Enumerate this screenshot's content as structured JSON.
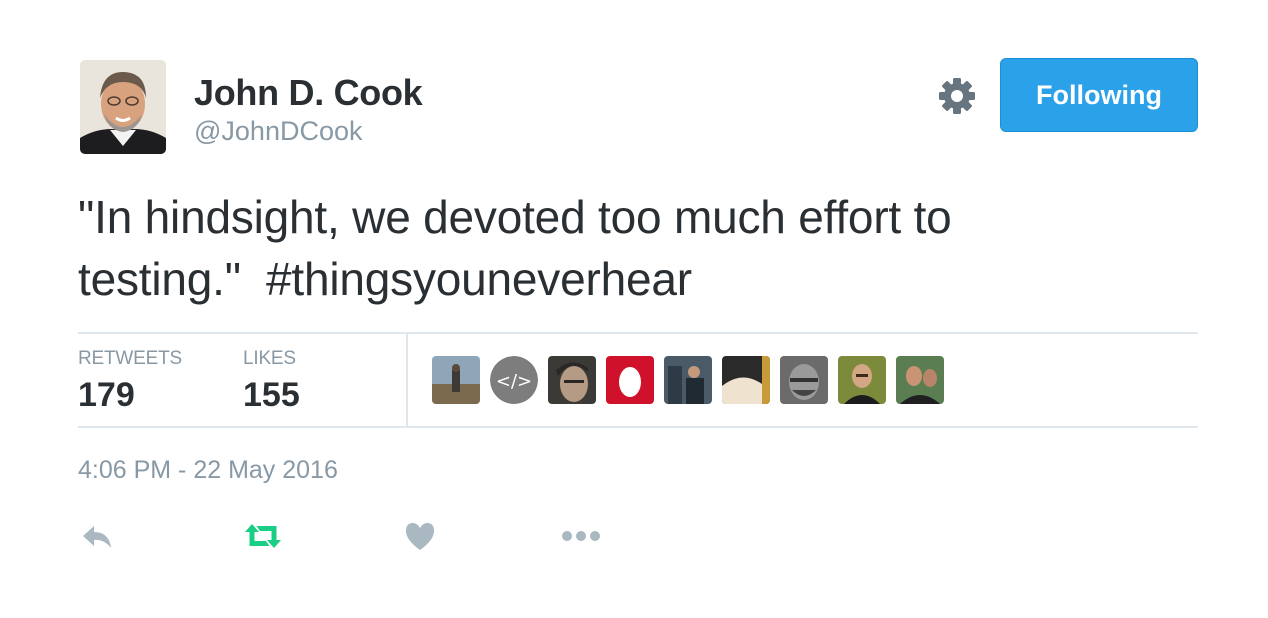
{
  "author": {
    "name": "John D. Cook",
    "handle": "@JohnDCook"
  },
  "header": {
    "follow_button_label": "Following",
    "settings_icon": "gear-icon"
  },
  "tweet": {
    "text": "\"In hindsight, we devoted too much effort to testing.\"",
    "hashtag": "#thingsyouneverhear",
    "timestamp": "4:06 PM - 22 May 2016"
  },
  "stats": {
    "retweets_label": "RETWEETS",
    "retweets_count": "179",
    "likes_label": "LIKES",
    "likes_count": "155"
  },
  "likers": [
    {
      "name": "liker-avatar-1"
    },
    {
      "name": "liker-avatar-2"
    },
    {
      "name": "liker-avatar-3"
    },
    {
      "name": "liker-avatar-4"
    },
    {
      "name": "liker-avatar-5"
    },
    {
      "name": "liker-avatar-6"
    },
    {
      "name": "liker-avatar-7"
    },
    {
      "name": "liker-avatar-8"
    },
    {
      "name": "liker-avatar-9"
    }
  ],
  "actions": [
    {
      "icon": "reply-icon"
    },
    {
      "icon": "retweet-icon",
      "color": "#19cf86"
    },
    {
      "icon": "heart-icon"
    },
    {
      "icon": "more-icon"
    }
  ],
  "colors": {
    "accent": "#2aa1e8",
    "retweet_active": "#19cf86",
    "muted": "#8899a6",
    "text": "#292f33"
  }
}
